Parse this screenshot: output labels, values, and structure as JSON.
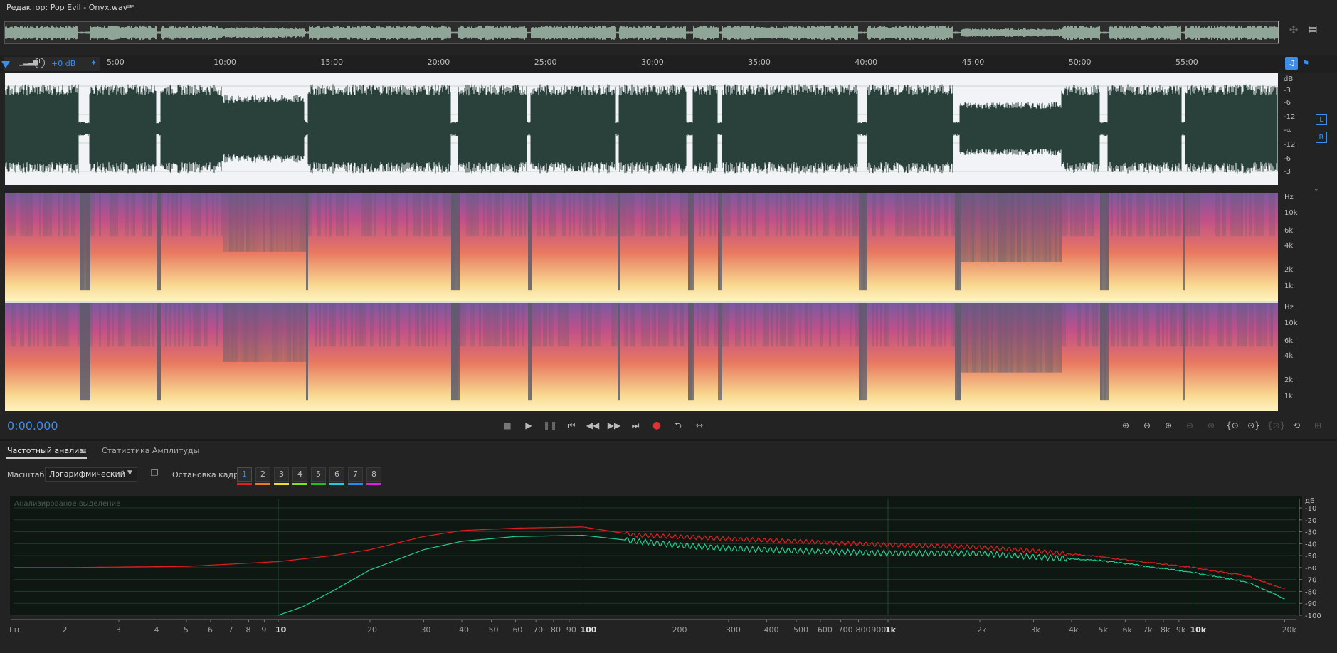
{
  "window": {
    "title": "Редактор: Pop Evil - Onyx.wav *",
    "menu_icon": "hamburger-icon"
  },
  "overview": {
    "zoom_fit_icon": "zoom-fit-icon",
    "panel_icon": "panel-toggle-icon"
  },
  "hud": {
    "volume_icon": "volume-bars-icon",
    "knob_icon": "volume-knob-icon",
    "volume_label": "+0 dB",
    "pin_icon": "pin-icon"
  },
  "ruler": {
    "ticks": [
      "5:00",
      "10:00",
      "15:00",
      "20:00",
      "25:00",
      "30:00",
      "35:00",
      "40:00",
      "45:00",
      "50:00",
      "55:00"
    ],
    "headphones_icon": "headphones-icon",
    "marker_icon": "marker-icon"
  },
  "waveform": {
    "db_labels": [
      "dB",
      "-3",
      "-6",
      "-12",
      "-∞",
      "-12",
      "-6",
      "-3"
    ],
    "channel_left": "L",
    "channel_right": "R"
  },
  "spectral": {
    "hz_labels": [
      "Hz",
      "10k",
      "6k",
      "4k",
      "2k",
      "1k"
    ]
  },
  "transport": {
    "time": "0:00.000",
    "buttons": [
      "stop",
      "play",
      "pause",
      "go-to-start",
      "rewind",
      "fast-forward",
      "go-to-end",
      "record",
      "loop",
      "skip-selection"
    ]
  },
  "zoom_toolbar": {
    "buttons": [
      "zoom-in-amplitude",
      "zoom-out-amplitude",
      "zoom-in-time",
      "zoom-out-time",
      "zoom-full",
      "zoom-in-at-start",
      "zoom-in-at-end",
      "zoom-selection",
      "zoom-reset",
      "zoom-history"
    ]
  },
  "panel": {
    "tab_frequency": "Частотный анализ",
    "tab_amplitude": "Статистика Амплитуды",
    "scale_label": "Масштаб:",
    "scale_value": "Логарифмический",
    "freeze_label": "Остановка кадра:",
    "frames": [
      "1",
      "2",
      "3",
      "4",
      "5",
      "6",
      "7",
      "8"
    ],
    "frame_colors": [
      "#e02020",
      "#f07820",
      "#f0e020",
      "#80e020",
      "#20c020",
      "#20d0e0",
      "#2090f0",
      "#e020e0"
    ]
  },
  "chart_data": {
    "type": "line",
    "label": "Анализированое выделение",
    "x_scale": "log",
    "x_unit_label": "Гц",
    "x_ticks": [
      "2",
      "3",
      "4",
      "5",
      "6",
      "7",
      "8",
      "9",
      "10",
      "20",
      "30",
      "40",
      "50",
      "60",
      "70",
      "80",
      "90",
      "100",
      "200",
      "300",
      "400",
      "500",
      "600",
      "700",
      "800",
      "900",
      "1k",
      "2k",
      "3k",
      "4k",
      "5k",
      "6k",
      "7k",
      "8k",
      "9k",
      "10k",
      "20k"
    ],
    "y_unit_label": "дБ",
    "y_ticks": [
      "-10",
      "-20",
      "-30",
      "-40",
      "-50",
      "-60",
      "-70",
      "-80",
      "-90",
      "-100"
    ],
    "ylim": [
      -100,
      0
    ],
    "grid": true,
    "series": [
      {
        "color": "#e02020",
        "x": [
          1,
          2,
          5,
          10,
          15,
          20,
          30,
          40,
          60,
          100,
          150,
          200,
          300,
          500,
          1000,
          2000,
          3000,
          5000,
          10000,
          15000,
          20000
        ],
        "y": [
          -60,
          -60,
          -59,
          -55,
          -50,
          -45,
          -34,
          -29,
          -27,
          -26,
          -33,
          -34,
          -36,
          -38,
          -41,
          -43,
          -46,
          -51,
          -60,
          -67,
          -78
        ]
      },
      {
        "color": "#20d090",
        "x": [
          10,
          12,
          15,
          20,
          30,
          40,
          60,
          100,
          150,
          200,
          300,
          500,
          1000,
          2000,
          3000,
          5000,
          10000,
          15000,
          20000
        ],
        "y": [
          -100,
          -93,
          -80,
          -62,
          -45,
          -38,
          -34,
          -33,
          -38,
          -41,
          -44,
          -46,
          -48,
          -48,
          -51,
          -54,
          -64,
          -72,
          -86
        ]
      }
    ]
  }
}
